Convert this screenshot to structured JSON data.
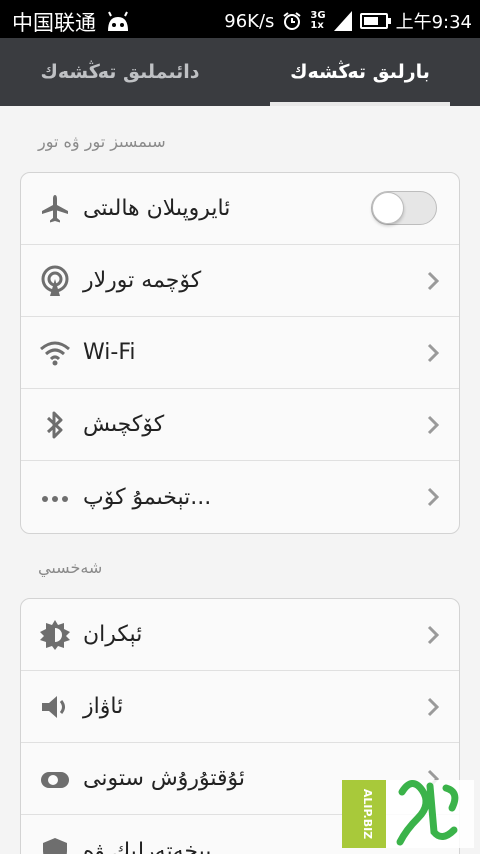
{
  "status_bar": {
    "carrier": "中国联通",
    "net_speed": "96K/s",
    "network_top": "3G",
    "network_bottom": "1x",
    "time": "上午9:34",
    "battery_level": 0.7
  },
  "tabs": [
    {
      "label": "بارلىق تەڭشەك",
      "active": true
    },
    {
      "label": "دائىملىق تەڭشەك",
      "active": false
    }
  ],
  "sections": [
    {
      "title": "سىمسىز تور ۋە تور",
      "items": [
        {
          "label": "ئايروپىلان ھالىتى",
          "icon": "airplane-icon",
          "control": "toggle",
          "on": false
        },
        {
          "label": "كۆچمە تورلار",
          "icon": "antenna-icon",
          "control": "chevron"
        },
        {
          "label": "Wi-Fi",
          "icon": "wifi-icon",
          "control": "chevron"
        },
        {
          "label": "كۆكچىش",
          "icon": "bluetooth-icon",
          "control": "chevron"
        },
        {
          "label": "تېخىمۇ كۆپ...",
          "icon": "more-icon",
          "control": "chevron"
        }
      ]
    },
    {
      "title": "شەخسىي",
      "items": [
        {
          "label": "ئېكران",
          "icon": "brightness-icon",
          "control": "chevron"
        },
        {
          "label": "ئاۋاز",
          "icon": "speaker-icon",
          "control": "chevron"
        },
        {
          "label": "ئۇقتۇرۇش ستونى",
          "icon": "notification-toggle-icon",
          "control": "chevron"
        },
        {
          "label": "بىخەتەرلىك ۋە",
          "icon": "security-icon",
          "control": "chevron"
        }
      ]
    }
  ],
  "watermark": {
    "text": "ALIP.BIZ"
  }
}
